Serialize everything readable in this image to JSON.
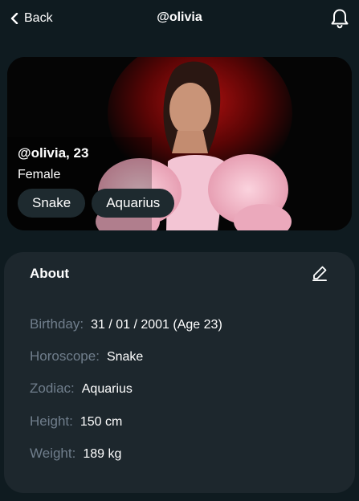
{
  "header": {
    "back_label": "Back",
    "title": "@olivia"
  },
  "profile": {
    "name_age": "@olivia, 23",
    "gender": "Female",
    "chips": [
      "Snake",
      "Aquarius"
    ]
  },
  "about": {
    "title": "About",
    "fields": [
      {
        "label": "Birthday:",
        "value": "31 / 01 / 2001 (Age 23)"
      },
      {
        "label": "Horoscope:",
        "value": "Snake"
      },
      {
        "label": "Zodiac:",
        "value": "Aquarius"
      },
      {
        "label": "Height:",
        "value": "150 cm"
      },
      {
        "label": "Weight:",
        "value": "189 kg"
      }
    ]
  },
  "colors": {
    "background": "#0f1b20",
    "card": "#1d272d",
    "chip": "#1e2a2f",
    "label": "#707e8c",
    "photo_glow": "#8a0a0a",
    "fur": "#f2b6c8"
  },
  "icons": {
    "back": "chevron-left-icon",
    "notifications": "bell-icon",
    "edit": "pencil-icon"
  }
}
